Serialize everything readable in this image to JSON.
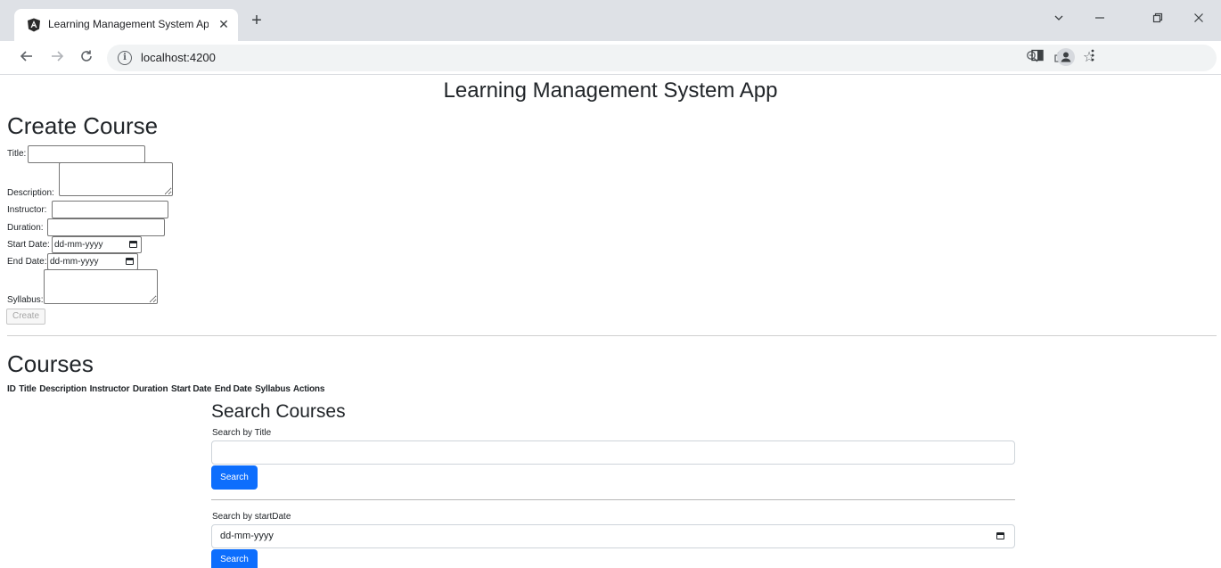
{
  "browser": {
    "tab_title": "Learning Management System App",
    "tab_close": "✕",
    "new_tab": "+",
    "url": "localhost:4200",
    "window_controls": [
      "chevron-down-icon",
      "minimize-icon",
      "restore-icon",
      "close-icon"
    ]
  },
  "page": {
    "app_title": "Learning Management System App",
    "create_heading": "Create Course",
    "form": {
      "title_label": "Title:",
      "description_label": "Description:",
      "instructor_label": "Instructor:",
      "duration_label": "Duration:",
      "start_date_label": "Start Date:",
      "start_date_placeholder": "dd-mm-yyyy",
      "end_date_label": "End Date:",
      "end_date_placeholder": "dd-mm-yyyy",
      "syllabus_label": "Syllabus:",
      "create_button": "Create"
    },
    "courses_heading": "Courses",
    "table_headers": [
      "ID",
      "Title",
      "Description",
      "Instructor",
      "Duration",
      "Start Date",
      "End Date",
      "Syllabus",
      "Actions"
    ],
    "search": {
      "heading": "Search Courses",
      "title_label": "Search by Title",
      "title_value": "",
      "title_button": "Search",
      "date_label": "Search by startDate",
      "date_placeholder": "dd-mm-yyyy",
      "date_button": "Search"
    }
  },
  "colors": {
    "primary": "#0d6efd",
    "tabstrip": "#dee1e6",
    "omnibox": "#f1f3f4"
  }
}
